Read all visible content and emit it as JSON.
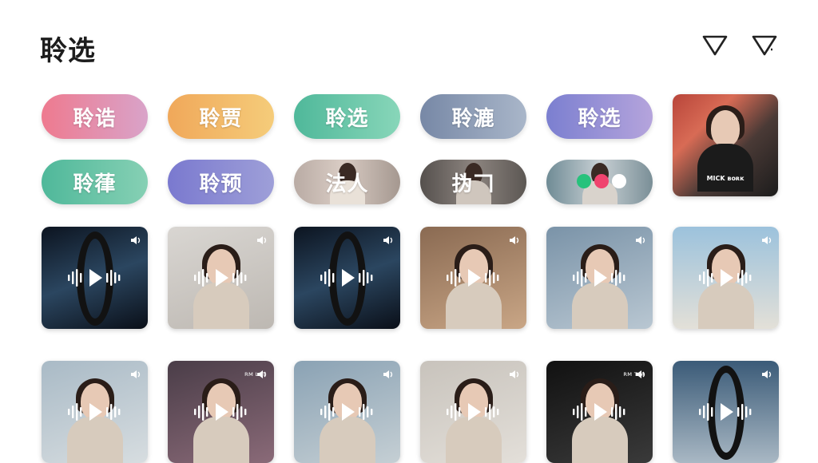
{
  "header": {
    "title": "聆选",
    "icons": [
      "filter-outline-icon",
      "filter-clear-icon"
    ]
  },
  "tags": [
    {
      "label": "聆诰",
      "kind": "gradient",
      "colors": [
        "#ee7a8f",
        "#d9a3c9"
      ]
    },
    {
      "label": "聆贾",
      "kind": "gradient",
      "colors": [
        "#f0a85a",
        "#f5cc7a"
      ]
    },
    {
      "label": "聆选",
      "kind": "gradient",
      "colors": [
        "#4fb89a",
        "#88d6b9"
      ]
    },
    {
      "label": "聆漉",
      "kind": "gradient",
      "colors": [
        "#7788a6",
        "#a9b6c9"
      ]
    },
    {
      "label": "聆选",
      "kind": "gradient",
      "colors": [
        "#7b7fd0",
        "#b5a4dc"
      ]
    },
    {
      "label": "聆葎",
      "kind": "gradient",
      "colors": [
        "#4fb89a",
        "#86d0b4"
      ]
    },
    {
      "label": "聆预",
      "kind": "gradient",
      "colors": [
        "#7a79cf",
        "#9e9fd8"
      ]
    },
    {
      "label": "法人",
      "kind": "photo"
    },
    {
      "label": "㧑𠃍",
      "kind": "photo"
    },
    {
      "label": "",
      "kind": "photo",
      "dots": [
        "#27c27c",
        "#f0436e",
        "#ffffff"
      ]
    }
  ],
  "featured_card": {
    "caption": "MICK ʙᴏʀᴋ"
  },
  "cards": [
    {
      "caption": "",
      "variant": "ring"
    },
    {
      "caption": "",
      "variant": "person"
    },
    {
      "caption": "",
      "variant": "ring"
    },
    {
      "caption": "",
      "variant": "person"
    },
    {
      "caption": "",
      "variant": "person"
    },
    {
      "caption": "",
      "variant": "person"
    },
    {
      "caption": "",
      "variant": "person"
    },
    {
      "caption": "ʀᴍ ʟᴏᴛ",
      "variant": "person"
    },
    {
      "caption": "",
      "variant": "person"
    },
    {
      "caption": "",
      "variant": "person"
    },
    {
      "caption": "ʀᴍ ᴛᴇᴀ",
      "variant": "person"
    },
    {
      "caption": "",
      "variant": "ring"
    }
  ],
  "colors": {
    "title": "#1d1d1d",
    "icon": "#222222",
    "wave": "#ffffff"
  }
}
